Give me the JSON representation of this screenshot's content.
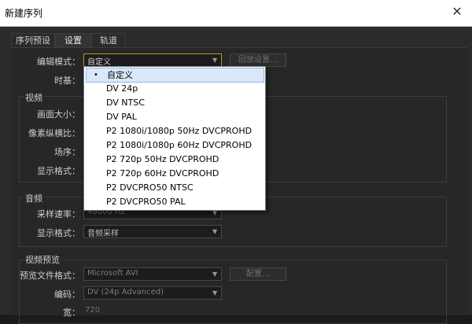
{
  "window": {
    "title": "新建序列",
    "close_symbol": "✕"
  },
  "tabs": [
    "序列预设",
    "设置",
    "轨道"
  ],
  "edit_mode": {
    "label": "编辑模式：",
    "value": "自定义",
    "side_button": "回放设置…"
  },
  "timebase": {
    "label": "时基："
  },
  "video": {
    "title": "视频",
    "frame_size_label": "画面大小：",
    "pixel_aspect_label": "像素纵横比：",
    "field_order_label": "场序：",
    "display_format_label": "显示格式："
  },
  "audio": {
    "title": "音频",
    "sample_rate_label": "采样速率：",
    "sample_rate_value": "48000 Hz",
    "display_format_label": "显示格式：",
    "display_format_value": "音频采样"
  },
  "video_preview": {
    "title": "视频预览",
    "file_format_label": "预览文件格式：",
    "file_format_value": "Microsoft AVI",
    "configure_button": "配置…",
    "codec_label": "编码：",
    "codec_value": "DV (24p Advanced)",
    "width_label": "宽：",
    "width_value": "720"
  },
  "dropdown": {
    "items": [
      "自定义",
      "DV 24p",
      "DV NTSC",
      "DV PAL",
      "P2 1080i/1080p 50Hz DVCPROHD",
      "P2 1080i/1080p 60Hz DVCPROHD",
      "P2 720p 50Hz DVCPROHD",
      "P2 720p 60Hz DVCPROHD",
      "P2 DVCPRO50 NTSC",
      "P2 DVCPRO50 PAL"
    ],
    "selected_index": 0,
    "bullet": "•"
  },
  "colors": {
    "focus_border": "#c98f2a",
    "selection_bg": "#dbe8f8"
  }
}
